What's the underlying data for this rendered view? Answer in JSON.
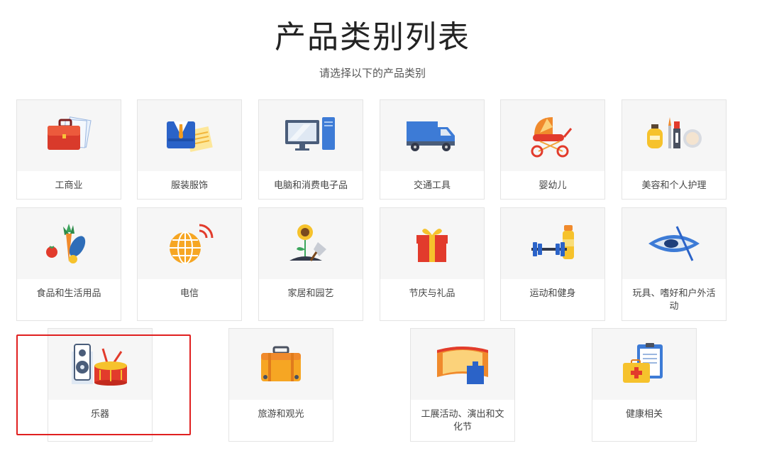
{
  "page": {
    "title": "产品类别列表",
    "subtitle": "请选择以下的产品类别"
  },
  "categories": [
    {
      "label": "工商业",
      "icon": "briefcase-icon"
    },
    {
      "label": "服装服饰",
      "icon": "suit-icon"
    },
    {
      "label": "电脑和消费电子品",
      "icon": "computer-icon"
    },
    {
      "label": "交通工具",
      "icon": "truck-icon"
    },
    {
      "label": "婴幼儿",
      "icon": "stroller-icon"
    },
    {
      "label": "美容和个人护理",
      "icon": "cosmetics-icon"
    },
    {
      "label": "食品和生活用品",
      "icon": "vegetables-icon"
    },
    {
      "label": "电信",
      "icon": "globe-signal-icon"
    },
    {
      "label": "家居和园艺",
      "icon": "sunflower-icon"
    },
    {
      "label": "节庆与礼品",
      "icon": "gift-icon"
    },
    {
      "label": "运动和健身",
      "icon": "dumbbell-icon"
    },
    {
      "label": "玩具、嗜好和户外活动",
      "icon": "kayak-icon"
    },
    {
      "label": "乐器",
      "icon": "drum-speaker-icon"
    },
    {
      "label": "旅游和观光",
      "icon": "suitcase-icon"
    },
    {
      "label": "工展活动、演出和文化节",
      "icon": "exhibition-booth-icon"
    },
    {
      "label": "健康相关",
      "icon": "first-aid-clipboard-icon"
    }
  ],
  "selected": "乐器",
  "colors": {
    "selection_border": "#e02020",
    "thumb_background": "#f6f6f6",
    "card_border": "#e4e4e4"
  }
}
